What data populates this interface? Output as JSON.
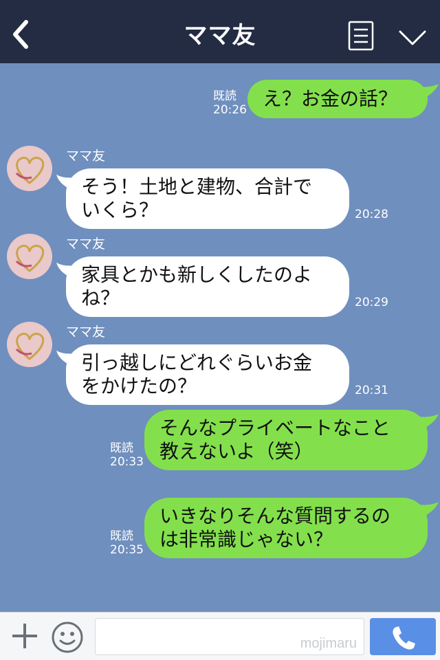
{
  "header": {
    "title": "ママ友",
    "back_icon": "chevron-left-icon",
    "menu_icon": "list-menu-icon",
    "collapse_icon": "chevron-down-icon"
  },
  "messages": [
    {
      "direction": "sent",
      "text": "え？お金の話？",
      "read": "既読",
      "time": "20:26"
    },
    {
      "direction": "received",
      "sender": "ママ友",
      "text": "そう！土地と建物、合計で\nいくら？",
      "time": "20:28"
    },
    {
      "direction": "received",
      "sender": "ママ友",
      "text": "家具とかも新しくしたのよ\nね？",
      "time": "20:29"
    },
    {
      "direction": "received",
      "sender": "ママ友",
      "text": "引っ越しにどれぐらいお金\nをかけたの？",
      "time": "20:31"
    },
    {
      "direction": "sent",
      "text": "そんなプライベートなこと\n教えないよ（笑）",
      "read": "既読",
      "time": "20:33"
    },
    {
      "direction": "sent",
      "text": "いきなりそんな質問するの\nは非常識じゃない？",
      "read": "既読",
      "time": "20:35"
    }
  ],
  "footer": {
    "plus_icon": "plus-icon",
    "emoji_icon": "smiley-icon",
    "input_value": "",
    "watermark": "mojimaru",
    "call_icon": "phone-icon"
  },
  "colors": {
    "header_bg": "#232c42",
    "chat_bg": "#6f8fbe",
    "sent_bubble": "#83e04c",
    "received_bubble": "#ffffff",
    "call_button": "#5a8fe6"
  }
}
